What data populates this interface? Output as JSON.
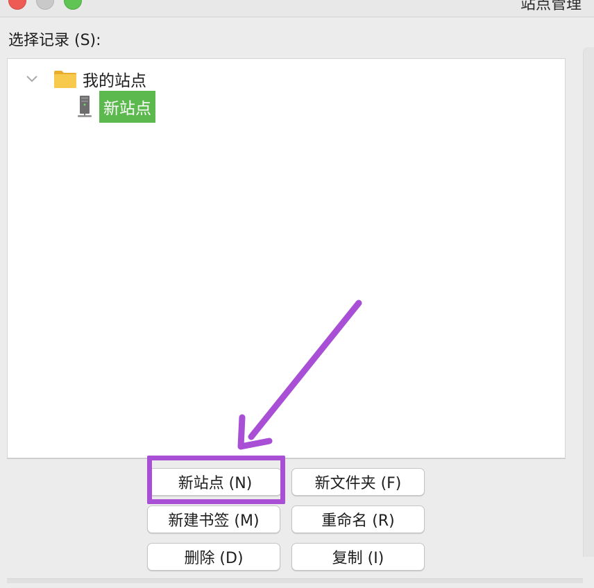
{
  "window": {
    "title": "站点管理"
  },
  "records": {
    "label": "选择记录 (S):",
    "tree": {
      "root": {
        "label": "我的站点",
        "icon": "folder-icon",
        "expanded": true
      },
      "child": {
        "label": "新站点",
        "icon": "server-icon",
        "selected": true
      }
    }
  },
  "buttons": {
    "new_site": "新站点 (N)",
    "new_folder": "新文件夹 (F)",
    "new_bookmark": "新建书签 (M)",
    "rename": "重命名 (R)",
    "delete": "删除 (D)",
    "duplicate": "复制 (I)"
  },
  "colors": {
    "selection": "#5cb94d",
    "annotation": "#a84fd6",
    "folder": "#f5c242"
  }
}
